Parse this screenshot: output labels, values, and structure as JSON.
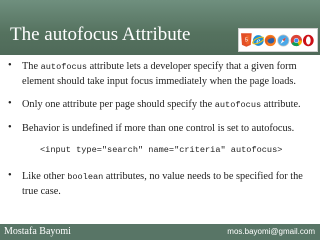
{
  "slide": {
    "title": "The autofocus Attribute"
  },
  "logos": [
    "html5-logo-icon",
    "ie-icon",
    "firefox-icon",
    "safari-icon",
    "chrome-icon",
    "opera-icon"
  ],
  "bullets": [
    {
      "pre": "The ",
      "code": "autofocus",
      "post": " attribute lets a developer specify that a given form element should take input focus immediately when the page loads."
    },
    {
      "pre": "Only one attribute per page should specify the ",
      "code": "autofocus",
      "post": " attribute."
    },
    {
      "text": "Behavior is undefined if more than one control is set to autofocus."
    },
    {
      "pre": "Like other ",
      "code": "boolean",
      "post": " attributes, no value needs to be specified for the true case."
    }
  ],
  "code_example": "<input type=\"search\" name=\"criteria\" autofocus>",
  "footer": {
    "author": "Mostafa Bayomi",
    "email": "mos.bayomi@gmail.com"
  },
  "colors": {
    "header": "#55725f",
    "footer": "#587566"
  }
}
